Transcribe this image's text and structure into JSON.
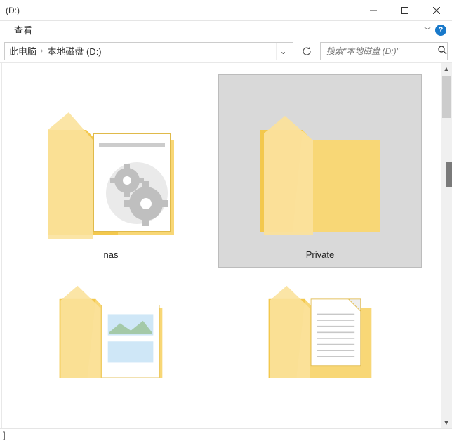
{
  "window": {
    "title": "(D:)"
  },
  "ribbon": {
    "tabs": [
      "查看"
    ],
    "expand_icon": "chevron-down"
  },
  "breadcrumb": {
    "parts": [
      "此电脑",
      "本地磁盘 (D:)"
    ]
  },
  "search": {
    "placeholder": "搜索\"本地磁盘 (D:)\""
  },
  "folders": [
    {
      "name": "nas",
      "kind": "gear",
      "selected": false
    },
    {
      "name": "Private",
      "kind": "empty",
      "selected": true
    },
    {
      "name": "",
      "kind": "pic",
      "selected": false
    },
    {
      "name": "",
      "kind": "doc",
      "selected": false
    }
  ],
  "statusbar": {
    "left_glyph": "]"
  }
}
